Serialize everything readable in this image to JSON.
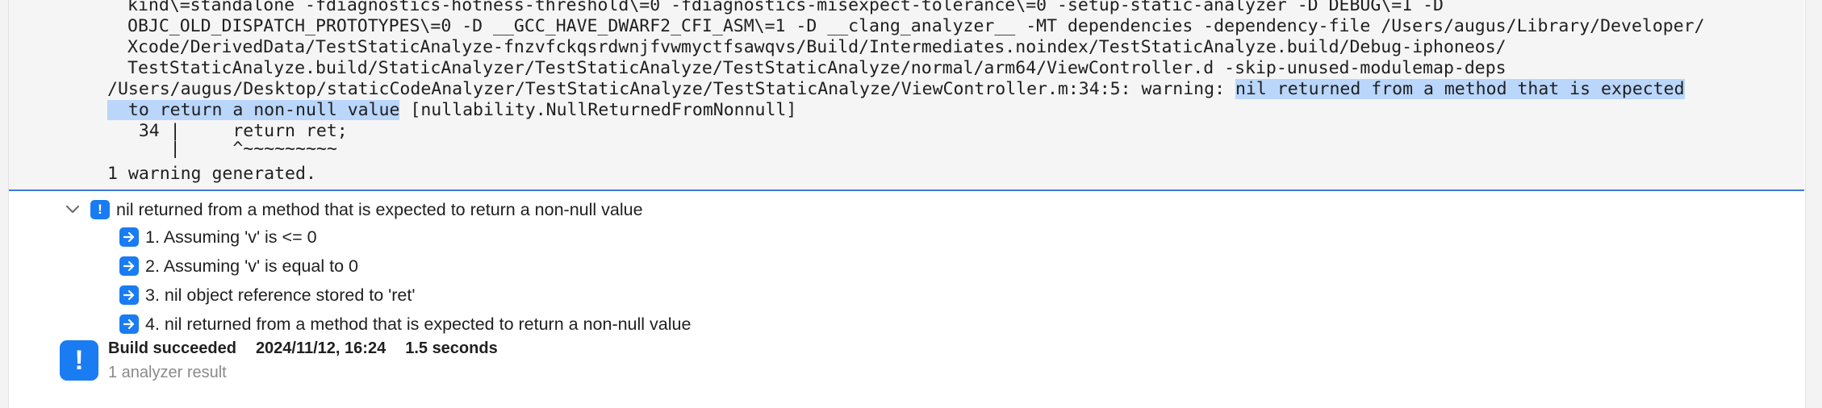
{
  "log": {
    "line1": "kind\\=standalone -fdiagnostics-hotness-threshold\\=0 -fdiagnostics-misexpect-tolerance\\=0 -setup-static-analyzer -D DEBUG\\=1 -D",
    "line2": "OBJC_OLD_DISPATCH_PROTOTYPES\\=0 -D __GCC_HAVE_DWARF2_CFI_ASM\\=1 -D __clang_analyzer__ -MT dependencies -dependency-file /Users/augus/Library/Developer/",
    "line3": "Xcode/DerivedData/TestStaticAnalyze-fnzvfckqsrdwnjfvwmyctfsawqvs/Build/Intermediates.noindex/TestStaticAnalyze.build/Debug-iphoneos/",
    "line4": "TestStaticAnalyze.build/StaticAnalyzer/TestStaticAnalyze/TestStaticAnalyze/normal/arm64/ViewController.d -skip-unused-modulemap-deps",
    "line5_prefix": "/Users/augus/Desktop/staticCodeAnalyzer/TestStaticAnalyze/TestStaticAnalyze/ViewController.m:34:5: warning: ",
    "line5_highlight": "nil returned from a method that is expected",
    "line6_highlight": "  to return a non-null value",
    "line6_suffix": " [nullability.NullReturnedFromNonnull]",
    "line7": "   34 |     return ret;",
    "line8": "      |     ^~~~~~~~~~",
    "line9": "1 warning generated."
  },
  "issue": {
    "title": "nil returned from a method that is expected to return a non-null value",
    "badge_glyph": "!"
  },
  "steps": [
    {
      "label": "1. Assuming 'v' is <= 0"
    },
    {
      "label": "2. Assuming 'v' is equal to 0"
    },
    {
      "label": "3. nil object reference stored to 'ret'"
    },
    {
      "label": "4. nil returned from a method that is expected to return a non-null value"
    }
  ],
  "build": {
    "status": "Build succeeded",
    "timestamp": "2024/11/12, 16:24",
    "duration": "1.5 seconds",
    "summary": "1 analyzer result",
    "badge_glyph": "!"
  },
  "colors": {
    "accent": "#1a7cf2",
    "selection": "#bad6fb"
  }
}
